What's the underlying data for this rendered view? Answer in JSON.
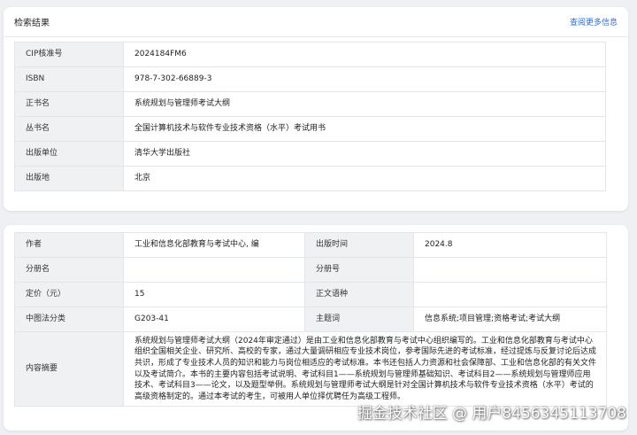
{
  "result_card": {
    "title": "检索结果",
    "more_link": "查阅更多信息",
    "rows": [
      {
        "label": "CIP核准号",
        "value": "2024184FM6"
      },
      {
        "label": "ISBN",
        "value": "978-7-302-66889-3"
      },
      {
        "label": "正书名",
        "value": "系统规划与管理师考试大纲"
      },
      {
        "label": "丛书名",
        "value": "全国计算机技术与软件专业技术资格（水平）考试用书"
      },
      {
        "label": "出版单位",
        "value": "清华大学出版社"
      },
      {
        "label": "出版地",
        "value": "北京"
      }
    ]
  },
  "detail_card": {
    "author_label": "作者",
    "author": "工业和信息化部教育与考试中心, 编",
    "pubtime_label": "出版时间",
    "pubtime": "2024.8",
    "volume_name_label": "分册名",
    "volume_name": "",
    "volume_no_label": "分册号",
    "volume_no": "",
    "price_label": "定价（元）",
    "price": "15",
    "language_label": "正文语种",
    "language": "",
    "clc_label": "中图法分类",
    "clc": "G203-41",
    "subject_label": "主题词",
    "subject": "信息系统;项目管理;资格考试;考试大纲",
    "summary_label": "内容摘要",
    "summary": "系统规划与管理师考试大纲（2024年审定通过）是由工业和信息化部教育与考试中心组织编写的。工业和信息化部教育与考试中心组织全国相关企业、研究所、高校的专家，通过大量调研相应专业技术岗位，参考国际先进的考试标准，经过提炼与反复讨论后达成共识，形成了专业技术人员的知识和能力与岗位相适应的考试标准。本书还包括人力资源和社会保障部、工业和信息化部的有关文件以及考试简介。本书的主要内容包括考试说明、考试科目1——系统规划与管理师基础知识、考试科目2——系统规划与管理师应用技术、考试科目3——论文，以及题型举例。系统规划与管理师考试大纲是针对全国计算机技术与软件专业技术资格（水平）考试的高级资格制定的。通过本考试的考生，可被用人单位择优聘任为高级工程师。"
  },
  "watermark": "掘金技术社区 @ 用户8456345113708"
}
